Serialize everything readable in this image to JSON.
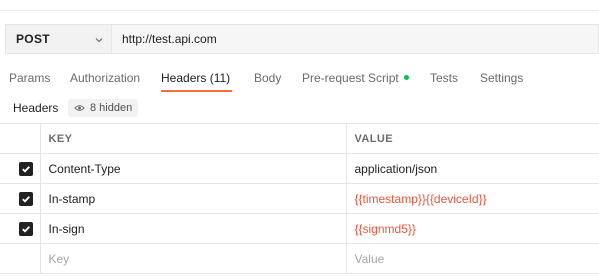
{
  "request": {
    "method": "POST",
    "url": "http://test.api.com"
  },
  "tabs": [
    {
      "label": "Params"
    },
    {
      "label": "Authorization"
    },
    {
      "label": "Headers (11)",
      "active": true
    },
    {
      "label": "Body"
    },
    {
      "label": "Pre-request Script",
      "indicator_color": "#0cbb52"
    },
    {
      "label": "Tests"
    },
    {
      "label": "Settings"
    }
  ],
  "headers_section": {
    "title": "Headers",
    "hidden_label": "8 hidden"
  },
  "table": {
    "columns": {
      "key": "KEY",
      "value": "VALUE"
    },
    "rows": [
      {
        "checked": true,
        "key": "Content-Type",
        "value": "application/json",
        "is_variable": false
      },
      {
        "checked": true,
        "key": "In-stamp",
        "value": "{{timestamp}}{{deviceId}}",
        "is_variable": true
      },
      {
        "checked": true,
        "key": "In-sign",
        "value": "{{signmd5}}",
        "is_variable": true
      }
    ],
    "placeholder": {
      "key": "Key",
      "value": "Value"
    }
  },
  "colors": {
    "accent": "#ff6c37",
    "variable": "#f05539",
    "indicator": "#0cbb52"
  }
}
